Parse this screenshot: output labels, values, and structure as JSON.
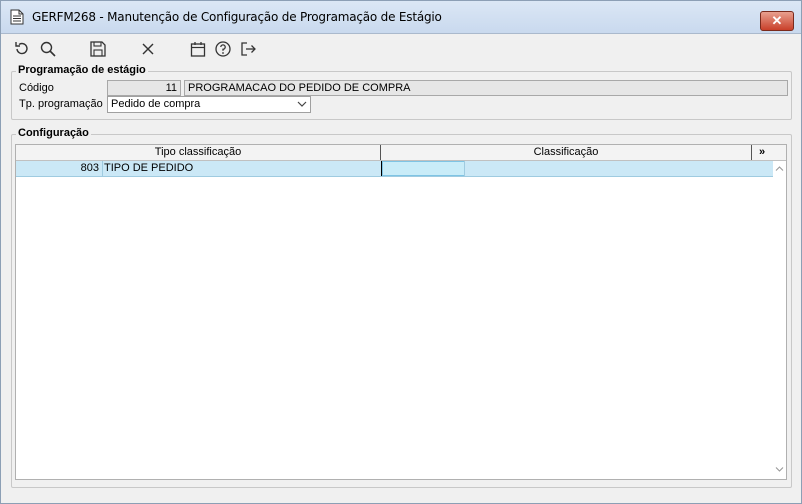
{
  "window": {
    "title": "GERFM268 - Manutenção de Configuração de Programação de Estágio",
    "close_label": "✕"
  },
  "toolbar": {
    "items": [
      "refresh-icon",
      "search-icon",
      "save-icon",
      "cancel-icon",
      "calendar-icon",
      "help-icon",
      "exit-icon"
    ]
  },
  "programacao": {
    "legend": "Programação de estágio",
    "codigo_label": "Código",
    "codigo_value": "11",
    "descricao_value": "PROGRAMACAO DO PEDIDO DE COMPRA",
    "tp_label": "Tp. programação",
    "tp_value": "Pedido de compra"
  },
  "configuracao": {
    "legend": "Configuração",
    "columns": [
      "Tipo classificação",
      "Classificação",
      "»"
    ],
    "rows": [
      {
        "code": "803",
        "tipo": "TIPO DE PEDIDO",
        "classificacao": ""
      }
    ]
  },
  "colors": {
    "titlebar": "#c9d9ee",
    "selected_row": "#cbe8f6",
    "close_button": "#c9402a"
  }
}
